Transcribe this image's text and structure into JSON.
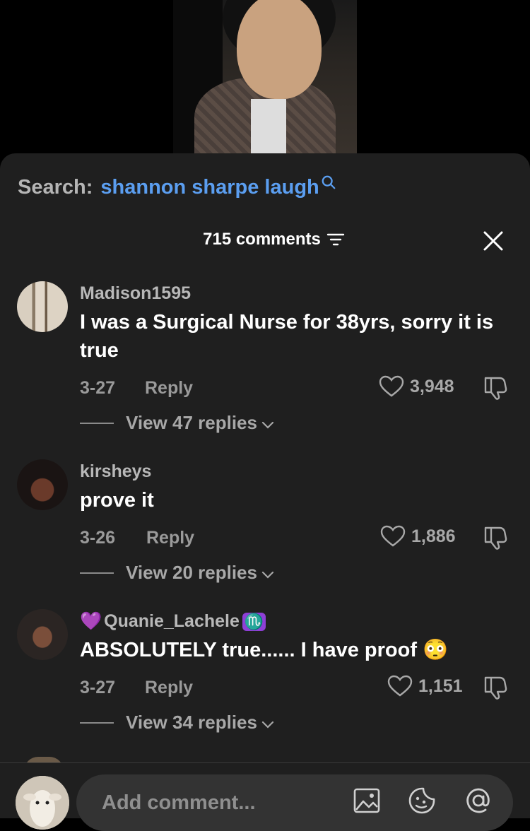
{
  "search": {
    "label": "Search:",
    "query": "shannon sharpe laugh"
  },
  "comments_header": {
    "count_label": "715 comments"
  },
  "comments": [
    {
      "username": "Madison1595",
      "text": "I was a Surgical Nurse for 38yrs, sorry it is true",
      "date": "3-27",
      "reply_label": "Reply",
      "likes": "3,948",
      "view_replies": "View 47 replies"
    },
    {
      "username": "kirsheys",
      "text": "prove it",
      "date": "3-26",
      "reply_label": "Reply",
      "likes": "1,886",
      "view_replies": "View 20 replies"
    },
    {
      "username": "Quanie_Lachele",
      "username_prefix_emoji": "💜",
      "username_suffix_emoji": "♏",
      "text": "ABSOLUTELY true...... I have proof",
      "text_emoji": "😳",
      "date": "3-27",
      "reply_label": "Reply",
      "likes": "1,151",
      "view_replies": "View 34 replies"
    }
  ],
  "composer": {
    "placeholder": "Add comment..."
  },
  "colors": {
    "sheet_bg": "#1f1f1f",
    "accent": "#5b9ef0",
    "muted": "#9a9a9a"
  }
}
